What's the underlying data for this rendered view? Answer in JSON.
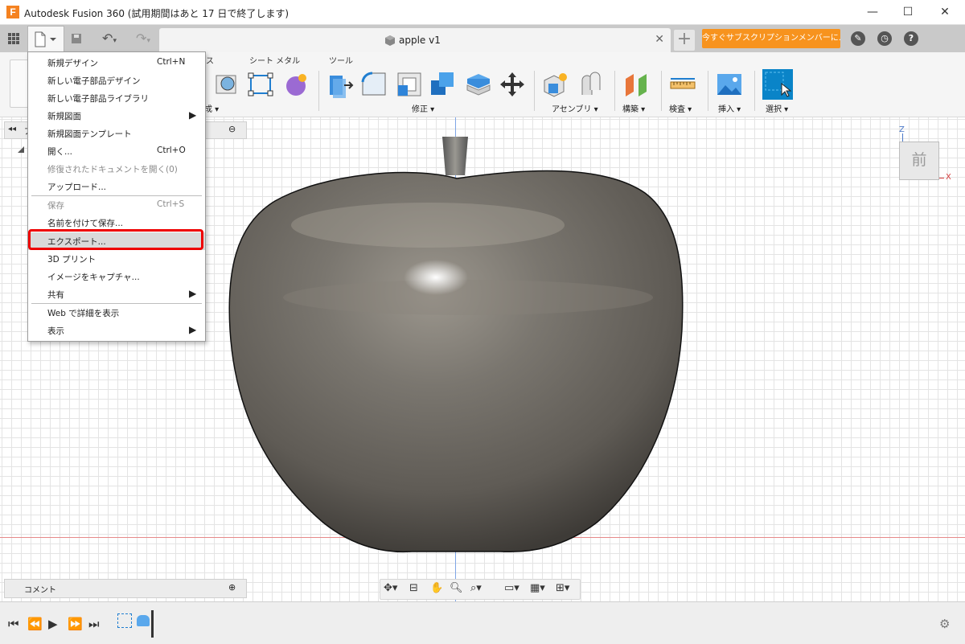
{
  "window": {
    "title": "Autodesk Fusion 360 (試用期間はあと 17 日で終了します)",
    "logo": "F",
    "minimize": "—",
    "maximize": "☐",
    "close": "✕"
  },
  "toolbar": {
    "document_tab": "apple v1",
    "subscribe_button": "今すぐサブスクリプションメンバーに..."
  },
  "ribbon": {
    "tabs": [
      "ス",
      "シート メタル",
      "ツール"
    ],
    "groups": [
      {
        "label": "成 ▾"
      },
      {
        "label": "修正 ▾"
      },
      {
        "label": "アセンブリ ▾"
      },
      {
        "label": "構築 ▾"
      },
      {
        "label": "検査 ▾"
      },
      {
        "label": "挿入 ▾"
      },
      {
        "label": "選択 ▾"
      }
    ]
  },
  "menu": {
    "items": [
      {
        "label": "新規デザイン",
        "shortcut": "Ctrl+N"
      },
      {
        "label": "新しい電子部品デザイン"
      },
      {
        "label": "新しい電子部品ライブラリ"
      },
      {
        "label": "新規図面",
        "submenu": true
      },
      {
        "label": "新規図面テンプレート"
      },
      {
        "label": "開く...",
        "shortcut": "Ctrl+O"
      },
      {
        "label": "修復されたドキュメントを開く(0)",
        "disabled": true
      },
      {
        "label": "アップロード..."
      },
      {
        "label": "保存",
        "shortcut": "Ctrl+S",
        "disabled": true
      },
      {
        "label": "名前を付けて保存..."
      },
      {
        "label": "エクスポート...",
        "highlighted": true
      },
      {
        "label": "3D プリント"
      },
      {
        "label": "イメージをキャプチャ..."
      },
      {
        "label": "共有",
        "submenu": true
      },
      {
        "label": "Web で詳細を表示"
      },
      {
        "label": "表示",
        "submenu": true
      }
    ]
  },
  "browser": {
    "title": "ア"
  },
  "comments": {
    "title": "コメント"
  },
  "viewcube": {
    "face": "前",
    "axis_z": "Z",
    "axis_x": "X"
  },
  "colors": {
    "accent": "#f7931e",
    "highlight_border": "#e00000",
    "select_blue": "#0a84c8",
    "apple_body": "#6e6b66"
  }
}
